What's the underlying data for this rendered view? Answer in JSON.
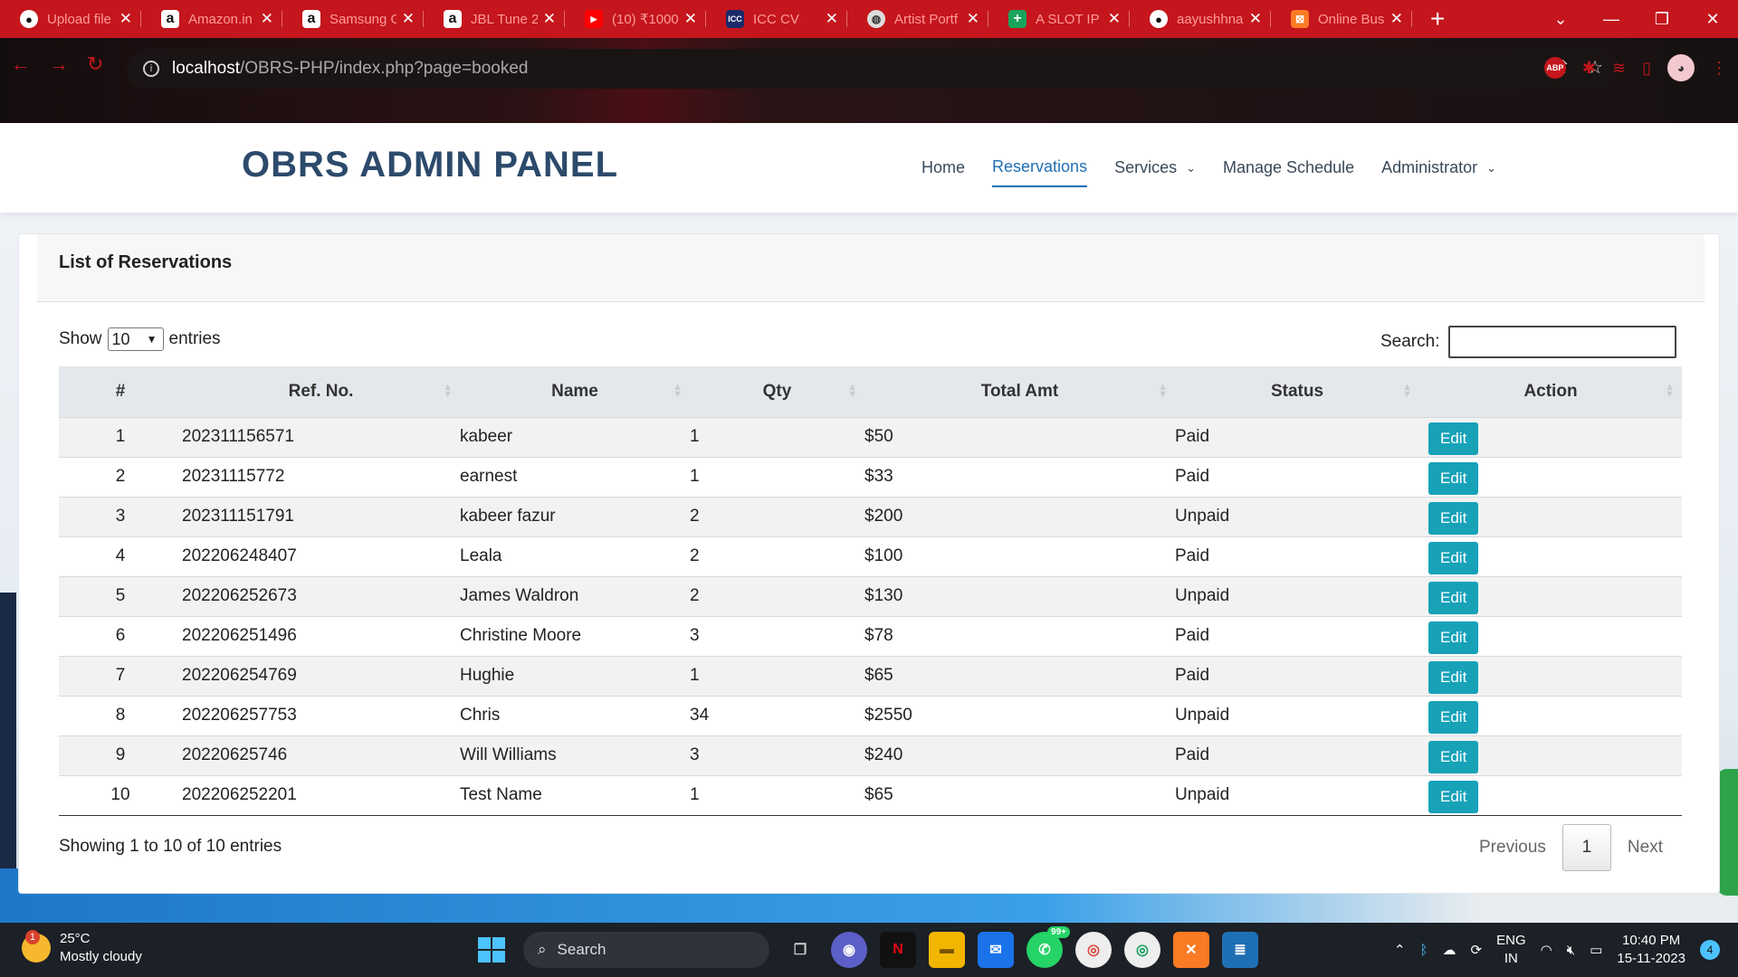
{
  "browser": {
    "tabs": [
      {
        "title": "Upload file",
        "icon": "github-icon"
      },
      {
        "title": "Amazon.in",
        "icon": "amazon-icon"
      },
      {
        "title": "Samsung G",
        "icon": "amazon-icon"
      },
      {
        "title": "JBL Tune 2",
        "icon": "amazon-icon"
      },
      {
        "title": "(10) ₹1000",
        "icon": "youtube-icon"
      },
      {
        "title": "ICC CV",
        "icon": "icc-icon"
      },
      {
        "title": "Artist Portf",
        "icon": "globe-icon"
      },
      {
        "title": "A SLOT IP",
        "icon": "sheets-icon"
      },
      {
        "title": "aayushhna",
        "icon": "github-icon"
      },
      {
        "title": "Online Bus",
        "icon": "xampp-icon"
      }
    ],
    "url_host": "localhost",
    "url_path": "/OBRS-PHP/index.php?page=booked",
    "abp_label": "ABP"
  },
  "header": {
    "brand": "OBRS ADMIN PANEL",
    "nav": [
      {
        "label": "Home",
        "active": false,
        "dropdown": false
      },
      {
        "label": "Reservations",
        "active": true,
        "dropdown": false
      },
      {
        "label": "Services",
        "active": false,
        "dropdown": true
      },
      {
        "label": "Manage Schedule",
        "active": false,
        "dropdown": false
      },
      {
        "label": "Administrator",
        "active": false,
        "dropdown": true
      }
    ]
  },
  "card": {
    "title": "List of Reservations",
    "show_label": "Show",
    "entries_value": "10",
    "entries_label": "entries",
    "search_label": "Search:",
    "columns": [
      "#",
      "Ref. No.",
      "Name",
      "Qty",
      "Total Amt",
      "Status",
      "Action"
    ],
    "rows": [
      {
        "num": "1",
        "ref": "202311156571",
        "name": "kabeer",
        "qty": "1",
        "amt": "$50",
        "status": "Paid",
        "action": "Edit"
      },
      {
        "num": "2",
        "ref": "20231115772",
        "name": "earnest",
        "qty": "1",
        "amt": "$33",
        "status": "Paid",
        "action": "Edit"
      },
      {
        "num": "3",
        "ref": "202311151791",
        "name": "kabeer fazur",
        "qty": "2",
        "amt": "$200",
        "status": "Unpaid",
        "action": "Edit"
      },
      {
        "num": "4",
        "ref": "202206248407",
        "name": "Leala",
        "qty": "2",
        "amt": "$100",
        "status": "Paid",
        "action": "Edit"
      },
      {
        "num": "5",
        "ref": "202206252673",
        "name": "James Waldron",
        "qty": "2",
        "amt": "$130",
        "status": "Unpaid",
        "action": "Edit"
      },
      {
        "num": "6",
        "ref": "202206251496",
        "name": "Christine Moore",
        "qty": "3",
        "amt": "$78",
        "status": "Paid",
        "action": "Edit"
      },
      {
        "num": "7",
        "ref": "202206254769",
        "name": "Hughie",
        "qty": "1",
        "amt": "$65",
        "status": "Paid",
        "action": "Edit"
      },
      {
        "num": "8",
        "ref": "202206257753",
        "name": "Chris",
        "qty": "34",
        "amt": "$2550",
        "status": "Unpaid",
        "action": "Edit"
      },
      {
        "num": "9",
        "ref": "20220625746",
        "name": "Will Williams",
        "qty": "3",
        "amt": "$240",
        "status": "Paid",
        "action": "Edit"
      },
      {
        "num": "10",
        "ref": "202206252201",
        "name": "Test Name",
        "qty": "1",
        "amt": "$65",
        "status": "Unpaid",
        "action": "Edit"
      }
    ],
    "info": "Showing 1 to 10 of 10 entries",
    "pager": {
      "prev": "Previous",
      "current": "1",
      "next": "Next"
    }
  },
  "taskbar": {
    "weather_badge": "1",
    "temperature": "25°C",
    "condition": "Mostly cloudy",
    "search_label": "Search",
    "whatsapp_badge": "99+",
    "lang_top": "ENG",
    "lang_bottom": "IN",
    "time": "10:40 PM",
    "date": "15-11-2023",
    "notifications": "4"
  },
  "colors": {
    "tab_strip": "#c4161c",
    "brand": "#2c4a6b",
    "nav_active": "#1f6fb5",
    "edit_button": "#17a2b8"
  }
}
